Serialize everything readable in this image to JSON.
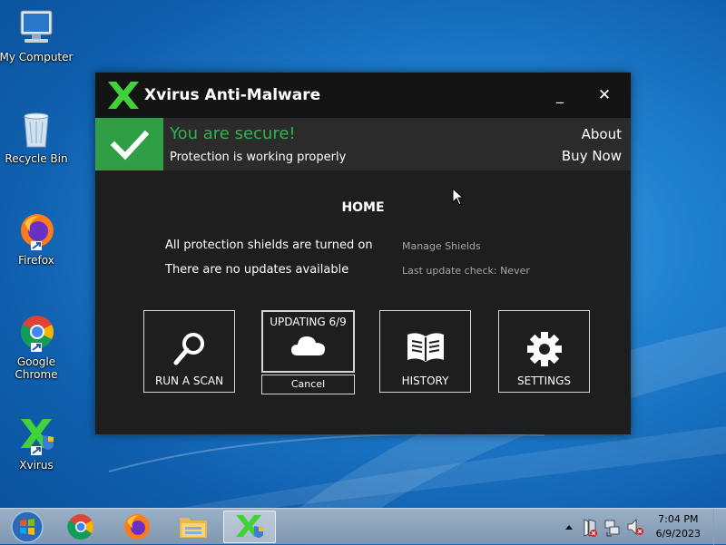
{
  "desktop": {
    "icons": [
      {
        "label": "My Computer",
        "icon": "computer-icon"
      },
      {
        "label": "Recycle Bin",
        "icon": "recycle-bin-icon"
      },
      {
        "label": "Firefox",
        "icon": "firefox-icon"
      },
      {
        "label": "Google Chrome",
        "icon": "chrome-icon"
      },
      {
        "label": "Xvirus",
        "icon": "xvirus-icon"
      }
    ]
  },
  "app": {
    "title": "Xvirus Anti-Malware",
    "minimize": "_",
    "close": "✕",
    "status": {
      "title": "You are secure!",
      "subtitle": "Protection is working properly",
      "about": "About",
      "buy_now": "Buy Now"
    },
    "home_title": "HOME",
    "info": [
      {
        "text": "All protection shields are turned on",
        "link": "Manage Shields"
      },
      {
        "text": "There are no updates available",
        "link": "Last update check: Never"
      }
    ],
    "tiles": {
      "scan": "RUN A SCAN",
      "updating": "UPDATING 6/9",
      "cancel": "Cancel",
      "history": "HISTORY",
      "settings": "SETTINGS"
    },
    "colors": {
      "accent_green": "#2fb34c",
      "logo_green": "#41d23a",
      "bg": "#1e1e1e"
    }
  },
  "taskbar": {
    "pinned": [
      "start-orb-icon",
      "chrome-icon",
      "firefox-icon",
      "explorer-icon",
      "xvirus-icon"
    ],
    "clock": {
      "time": "7:04 PM",
      "date": "6/9/2023"
    }
  }
}
